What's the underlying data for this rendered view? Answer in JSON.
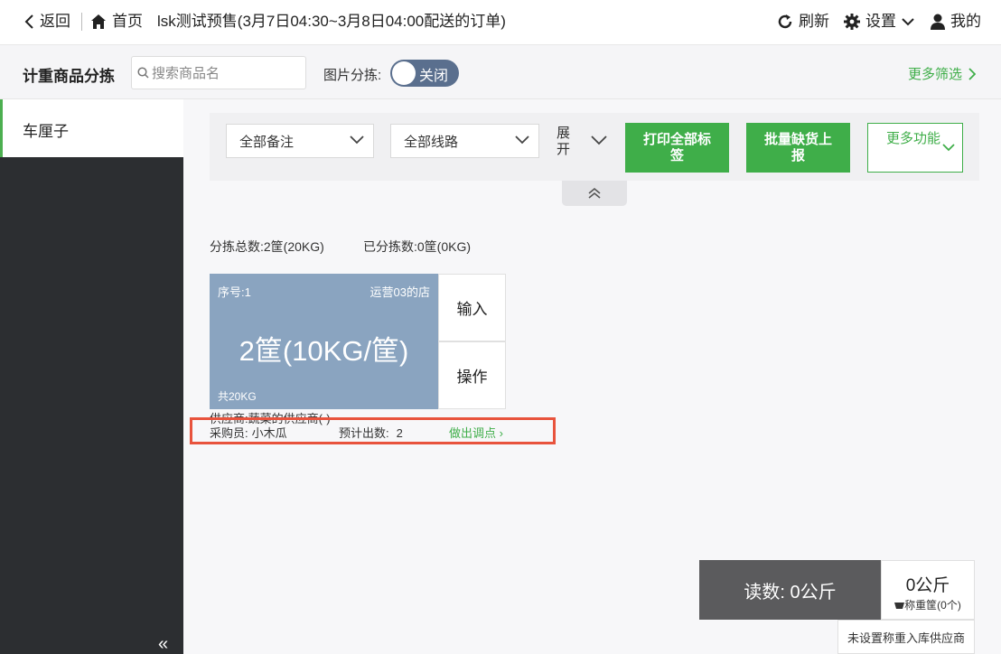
{
  "topbar": {
    "back_label": "返回",
    "home_label": "首页",
    "page_title": "lsk测试预售(3月7日04:30~3月8日04:00配送的订单)",
    "refresh_label": "刷新",
    "settings_label": "设置",
    "profile_label": "我的"
  },
  "toolbar": {
    "section_title": "计重商品分拣",
    "search_placeholder": "搜索商品名",
    "image_sort_label": "图片分拣:",
    "image_sort_toggle": "关闭",
    "more_filters": "更多筛选"
  },
  "sidebar": {
    "items": [
      {
        "label": "车厘子",
        "active": true
      }
    ],
    "collapse_icon": "«"
  },
  "filters": {
    "remark_select": "全部备注",
    "route_select": "全部线路",
    "expand_label": "展开",
    "print_all_button": "打印全部标签",
    "batch_report_button": "批量缺货上报",
    "more_functions_button": "更多功能"
  },
  "summary": {
    "total_label": "分拣总数:",
    "total_value": "2筐(20KG)",
    "done_label": "已分拣数:",
    "done_value": "0筐(0KG)"
  },
  "card": {
    "seq": "序号:1",
    "shop": "运营03的店",
    "quantity": "2筐(10KG/筐)",
    "total": "共20KG",
    "input_button": "输入",
    "action_button": "操作",
    "supplier_label": "供应商:",
    "supplier_value": "蔬菜的供应商(-)",
    "buyer_label": "采购员:",
    "buyer_value": "小木瓜",
    "expected_label": "预计出数:",
    "expected_value": "2",
    "link": "做出调点"
  },
  "scale": {
    "reading": "读数: 0公斤",
    "weight": "0公斤",
    "tare": "称重筐(0个)",
    "no_supplier": "未设置称重入库供应商"
  },
  "colors": {
    "accent_green": "#3fae49",
    "card_blue": "#8aa4c0",
    "highlight_red": "#e8533d"
  }
}
